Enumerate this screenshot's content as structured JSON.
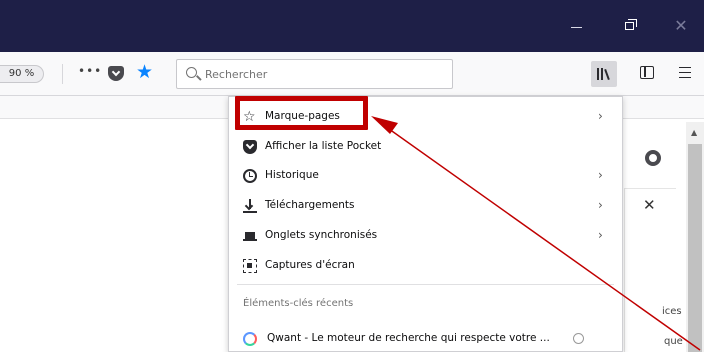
{
  "toolbar": {
    "zoom": "90 %",
    "overflow": "•••",
    "search_placeholder": "Rechercher"
  },
  "menu": {
    "items": [
      {
        "label": "Marque-pages",
        "icon": "star-icon",
        "has_arrow": true
      },
      {
        "label": "Afficher la liste Pocket",
        "icon": "pocket-icon",
        "has_arrow": false
      },
      {
        "label": "Historique",
        "icon": "clock-icon",
        "has_arrow": true
      },
      {
        "label": "Téléchargements",
        "icon": "download-icon",
        "has_arrow": true
      },
      {
        "label": "Onglets synchronisés",
        "icon": "synced-tabs-icon",
        "has_arrow": true
      },
      {
        "label": "Captures d'écran",
        "icon": "screenshot-icon",
        "has_arrow": false
      }
    ],
    "recent_heading": "Éléments-clés récents",
    "recent_items": [
      {
        "label": "Qwant - Le moteur de recherche qui respecte votre ...",
        "icon": "qwant-icon"
      }
    ],
    "arrow_glyph": "›"
  },
  "page": {
    "partial_1": "ices",
    "partial_2": "que"
  },
  "colors": {
    "titlebar": "#1e1f47",
    "accent_star": "#0a84ff",
    "highlight": "#c00000"
  }
}
